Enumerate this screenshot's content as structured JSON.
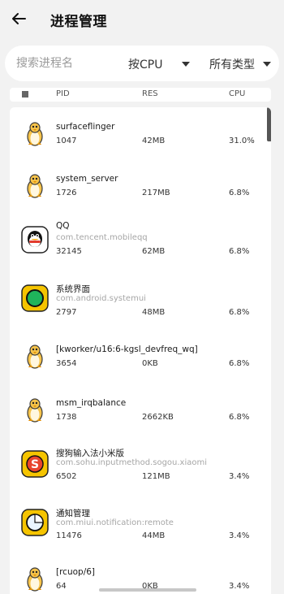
{
  "header": {
    "title": "进程管理"
  },
  "filter": {
    "search_placeholder": "搜索进程名",
    "sort_value": "按CPU",
    "type_value": "所有类型"
  },
  "columns": {
    "pid": "PID",
    "res": "RES",
    "cpu": "CPU"
  },
  "processes": [
    {
      "name": "surfaceflinger",
      "package": "",
      "pid": "1047",
      "res": "42MB",
      "cpu": "31.0%",
      "icon": "linux-penguin-icon"
    },
    {
      "name": "system_server",
      "package": "",
      "pid": "1726",
      "res": "217MB",
      "cpu": "6.8%",
      "icon": "linux-penguin-icon"
    },
    {
      "name": "QQ",
      "package": "com.tencent.mobileqq",
      "pid": "32145",
      "res": "62MB",
      "cpu": "6.8%",
      "icon": "qq-app-icon"
    },
    {
      "name": "系统界面",
      "package": "com.android.systemui",
      "pid": "2797",
      "res": "48MB",
      "cpu": "6.8%",
      "icon": "systemui-app-icon"
    },
    {
      "name": "[kworker/u16:6-kgsl_devfreq_wq]",
      "package": "",
      "pid": "3654",
      "res": "0KB",
      "cpu": "6.8%",
      "icon": "linux-penguin-icon"
    },
    {
      "name": "msm_irqbalance",
      "package": "",
      "pid": "1738",
      "res": "2662KB",
      "cpu": "6.8%",
      "icon": "linux-penguin-icon"
    },
    {
      "name": "搜狗输入法小米版",
      "package": "com.sohu.inputmethod.sogou.xiaomi",
      "pid": "6502",
      "res": "121MB",
      "cpu": "3.4%",
      "icon": "sogou-app-icon"
    },
    {
      "name": "通知管理",
      "package": "com.miui.notification:remote",
      "pid": "11476",
      "res": "44MB",
      "cpu": "3.4%",
      "icon": "notification-app-icon"
    },
    {
      "name": "[rcuop/6]",
      "package": "",
      "pid": "64",
      "res": "0KB",
      "cpu": "3.4%",
      "icon": "linux-penguin-icon"
    }
  ],
  "colors": {
    "accent_yellow": "#f5c400",
    "background": "#f2f2f2",
    "card": "#ffffff"
  }
}
